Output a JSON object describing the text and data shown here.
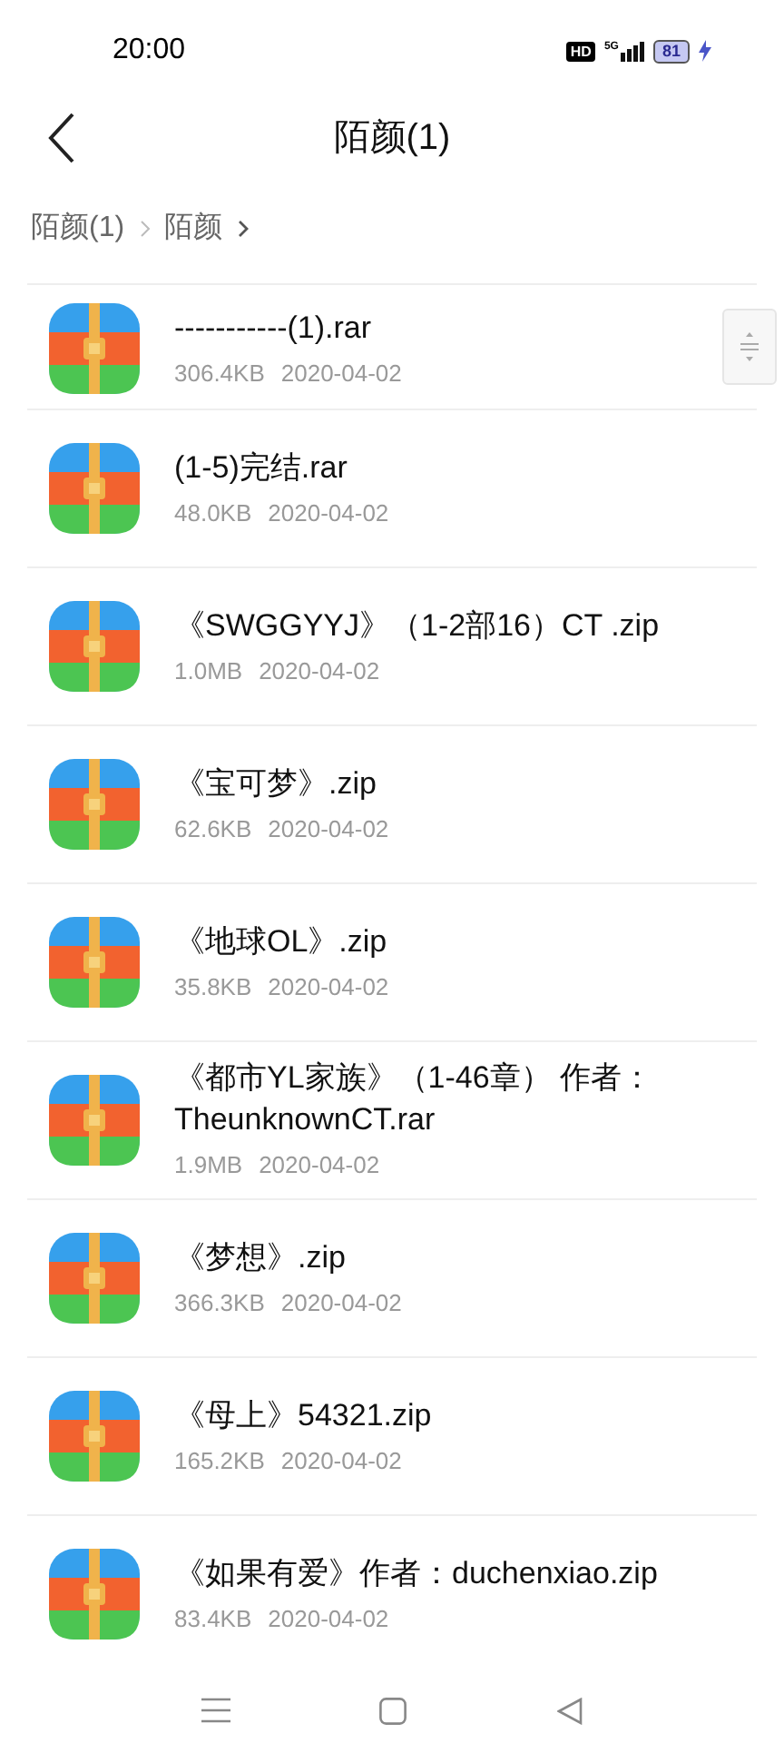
{
  "status_bar": {
    "time": "20:00",
    "hd": "HD",
    "network": "5G",
    "battery": "81"
  },
  "header": {
    "title": "陌颜(1)"
  },
  "breadcrumb": [
    {
      "label": "陌颜(1)"
    },
    {
      "label": "陌颜"
    }
  ],
  "files": [
    {
      "name": "-----------(1).rar",
      "size": "306.4KB",
      "date": "2020-04-02"
    },
    {
      "name": "(1-5)完结.rar",
      "size": "48.0KB",
      "date": "2020-04-02"
    },
    {
      "name": "《SWGGYYJ》（1-2部16）CT .zip",
      "size": "1.0MB",
      "date": "2020-04-02"
    },
    {
      "name": "《宝可梦》.zip",
      "size": "62.6KB",
      "date": "2020-04-02"
    },
    {
      "name": "《地球OL》.zip",
      "size": "35.8KB",
      "date": "2020-04-02"
    },
    {
      "name": "《都市YL家族》（1-46章） 作者：TheunknownCT.rar",
      "size": "1.9MB",
      "date": "2020-04-02"
    },
    {
      "name": "《梦想》.zip",
      "size": "366.3KB",
      "date": "2020-04-02"
    },
    {
      "name": "《母上》54321.zip",
      "size": "165.2KB",
      "date": "2020-04-02"
    },
    {
      "name": "《如果有爱》作者：duchenxiao.zip",
      "size": "83.4KB",
      "date": "2020-04-02"
    }
  ]
}
